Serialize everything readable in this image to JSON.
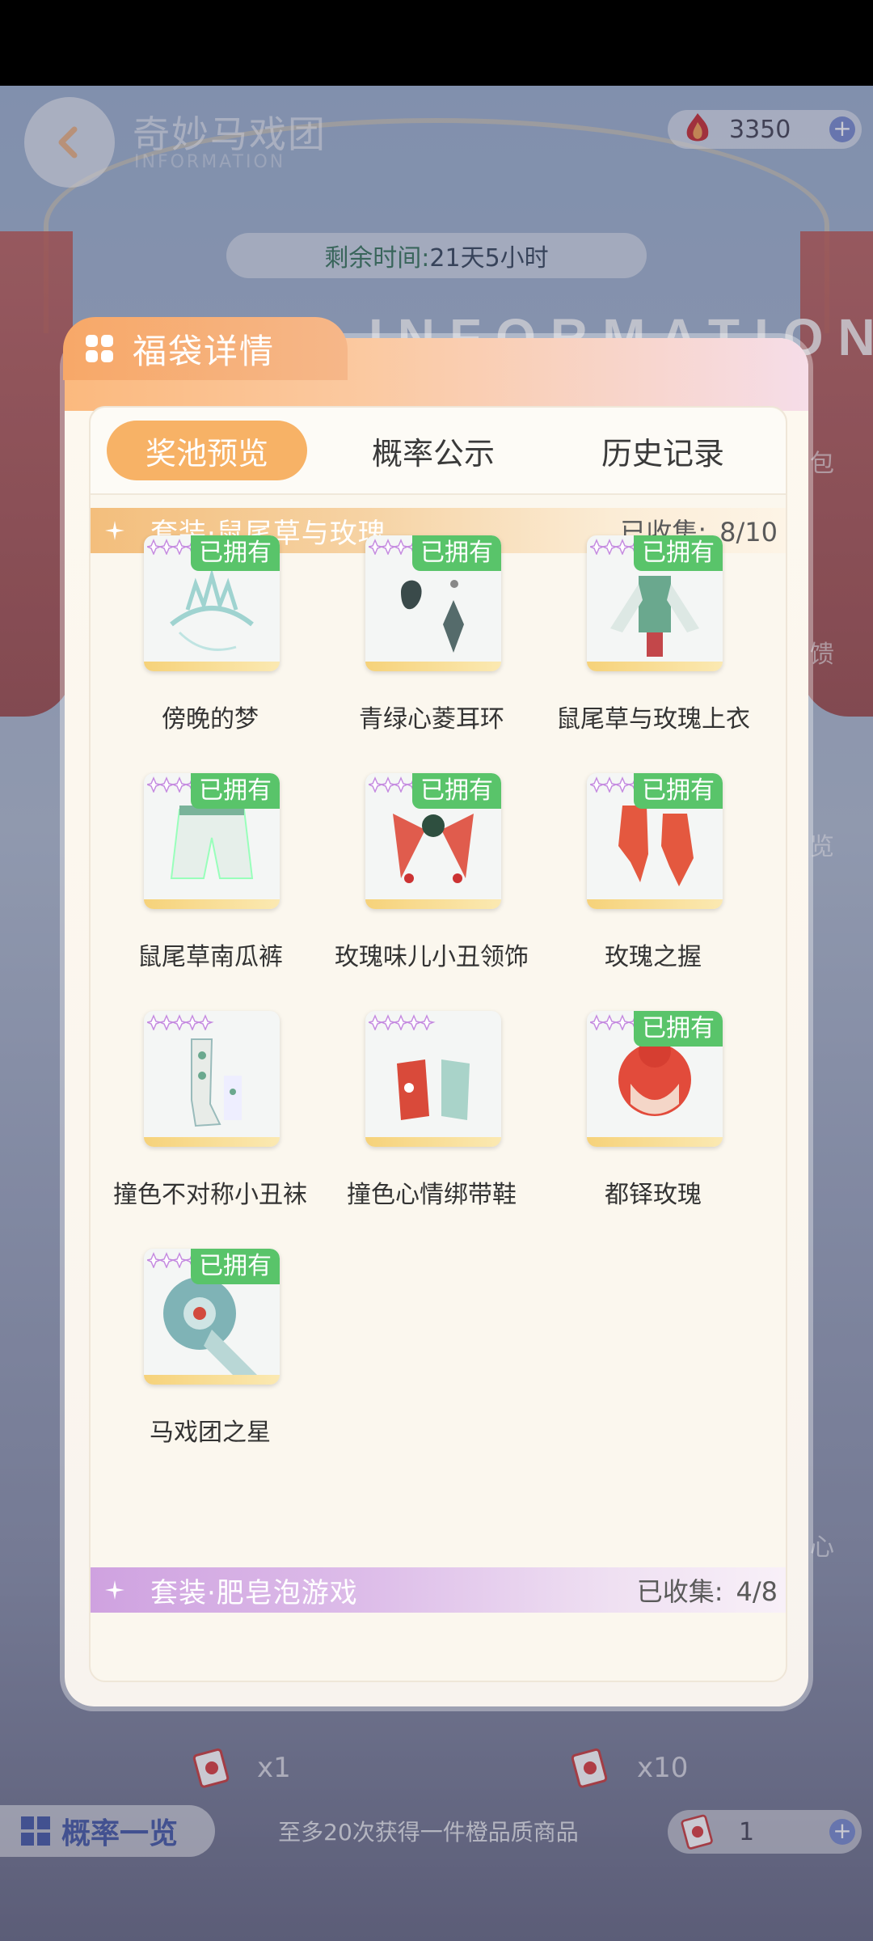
{
  "header": {
    "title": "奇妙马戏团",
    "subtitle": "INFORMATION",
    "currency_value": "3350",
    "remaining_label": "剩余时间:",
    "remaining_value": "21天5小时",
    "info_banner": "INFORMATION"
  },
  "side_labels": [
    "包",
    "馈",
    "览",
    "心"
  ],
  "modal": {
    "title": "福袋详情",
    "tabs": [
      {
        "label": "奖池预览",
        "active": true
      },
      {
        "label": "概率公示",
        "active": false
      },
      {
        "label": "历史记录",
        "active": false
      }
    ],
    "sets": [
      {
        "name": "套装·鼠尾草与玫瑰",
        "collected_label": "已收集:",
        "collected_value": "8/10",
        "items": [
          {
            "name": "傍晚的梦",
            "owned": true,
            "icon": "tiara-icon"
          },
          {
            "name": "青绿心菱耳环",
            "owned": true,
            "icon": "earring-icon"
          },
          {
            "name": "鼠尾草与玫瑰上衣",
            "owned": true,
            "icon": "top-icon"
          },
          {
            "name": "鼠尾草南瓜裤",
            "owned": true,
            "icon": "pants-icon"
          },
          {
            "name": "玫瑰味儿小丑领饰",
            "owned": true,
            "icon": "collar-icon"
          },
          {
            "name": "玫瑰之握",
            "owned": true,
            "icon": "gloves-icon"
          },
          {
            "name": "撞色不对称小丑袜",
            "owned": false,
            "icon": "socks-icon"
          },
          {
            "name": "撞色心情绑带鞋",
            "owned": false,
            "icon": "shoes-icon"
          },
          {
            "name": "都铎玫瑰",
            "owned": true,
            "icon": "hair-icon"
          },
          {
            "name": "马戏团之星",
            "owned": true,
            "icon": "eye-makeup-icon"
          }
        ]
      },
      {
        "name": "套装·肥皂泡游戏",
        "collected_label": "已收集:",
        "collected_value": "4/8",
        "items": []
      }
    ],
    "owned_badge": "已拥有"
  },
  "footer": {
    "draw_one_qty": "x1",
    "draw_ten_qty": "x10",
    "rate_button": "概率一览",
    "note": "至多20次获得一件橙品质商品",
    "ticket_count": "1"
  },
  "colors": {
    "accent_orange": "#f7b266",
    "owned_green": "#59c46a",
    "set1_bar": "#f3be7c",
    "set2_bar": "#cfa2e0"
  }
}
